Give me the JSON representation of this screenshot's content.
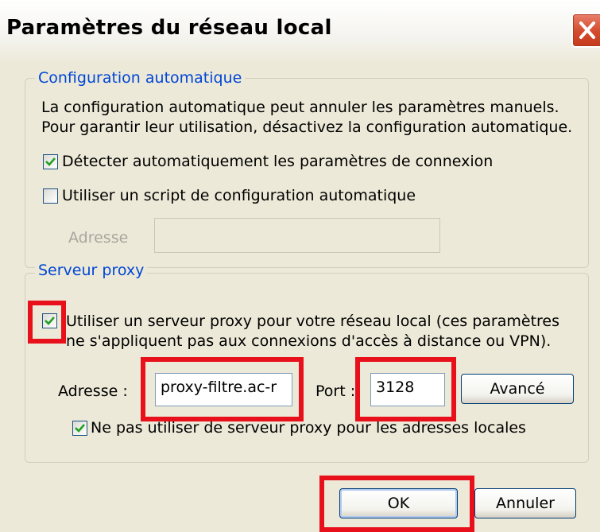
{
  "window": {
    "title": "Paramètres du réseau local"
  },
  "auto_config": {
    "legend": "Configuration automatique",
    "description_line1": "La configuration automatique peut annuler les paramètres manuels.",
    "description_line2": "Pour garantir leur utilisation, désactivez la configuration automatique.",
    "detect_label": "Détecter automatiquement les paramètres de connexion",
    "detect_checked": true,
    "script_label": "Utiliser un script de configuration automatique",
    "script_checked": false,
    "address_label": "Adresse",
    "address_value": ""
  },
  "proxy": {
    "legend": "Serveur proxy",
    "use_proxy_line1": "Utiliser un serveur proxy pour votre réseau local (ces paramètres",
    "use_proxy_line2": "ne s'appliquent pas aux connexions d'accès à distance ou VPN).",
    "use_proxy_checked": true,
    "address_label": "Adresse :",
    "address_value": "proxy-filtre.ac-r",
    "port_label": "Port :",
    "port_value": "3128",
    "advanced_label": "Avancé",
    "bypass_label": "Ne pas utiliser de serveur proxy pour les adresses locales",
    "bypass_checked": true
  },
  "buttons": {
    "ok": "OK",
    "cancel": "Annuler"
  },
  "colors": {
    "highlight": "#e8101a",
    "legend": "#0046d5",
    "background": "#ece9d8"
  }
}
